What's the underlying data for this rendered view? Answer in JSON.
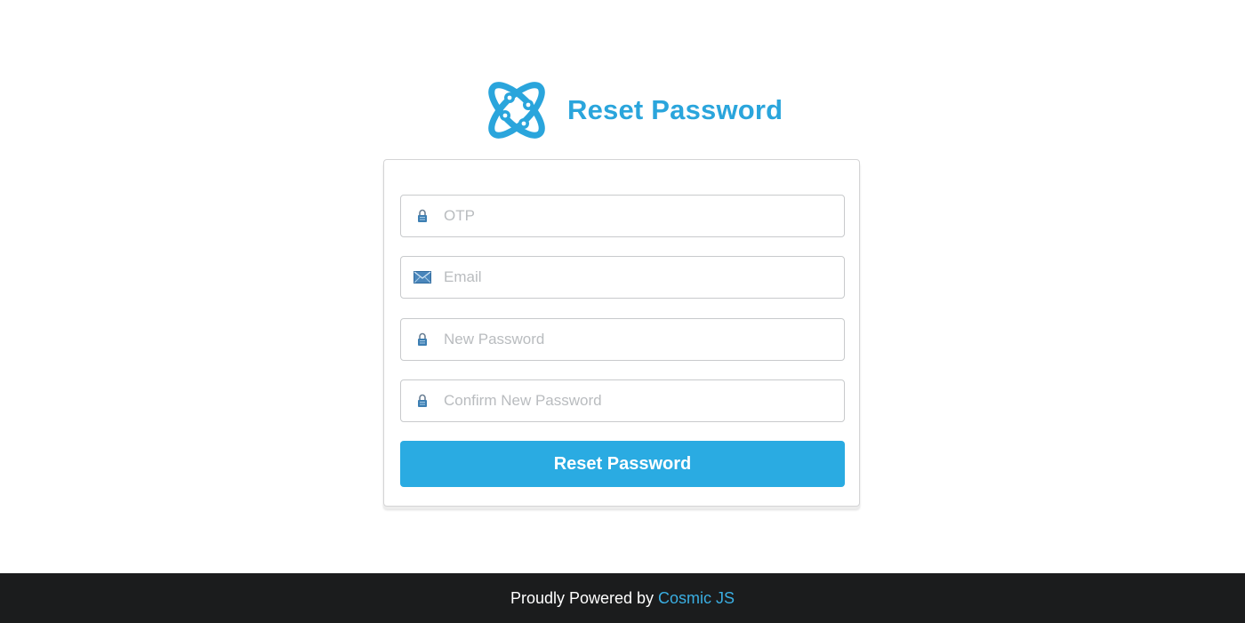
{
  "header": {
    "title": "Reset Password",
    "logo_icon": "cosmic-atom-icon"
  },
  "form": {
    "fields": [
      {
        "icon": "lock-icon",
        "placeholder": "OTP",
        "value": ""
      },
      {
        "icon": "mail-icon",
        "placeholder": "Email",
        "value": ""
      },
      {
        "icon": "lock-icon",
        "placeholder": "New Password",
        "value": ""
      },
      {
        "icon": "lock-icon",
        "placeholder": "Confirm New Password",
        "value": ""
      }
    ],
    "submit_label": "Reset Password"
  },
  "footer": {
    "text": "Proudly Powered by",
    "link_text": "Cosmic JS"
  },
  "colors": {
    "accent": "#2aabe2",
    "title": "#2aa5dc",
    "footer_bg": "#1b1c1d"
  }
}
